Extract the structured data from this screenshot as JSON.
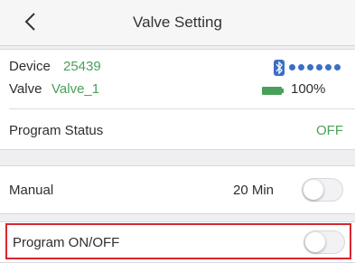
{
  "navbar": {
    "title": "Valve Setting",
    "back_icon": "chevron-left-icon"
  },
  "device": {
    "label": "Device",
    "id": "25439"
  },
  "valve": {
    "label": "Valve",
    "name": "Valve_1"
  },
  "status": {
    "bluetooth_icon": "bluetooth-icon",
    "signal_icon": "signal-dots-icon",
    "battery_icon": "battery-icon",
    "battery": "100%"
  },
  "program_status": {
    "label": "Program Status",
    "value": "OFF"
  },
  "manual": {
    "label": "Manual",
    "duration": "20 Min",
    "toggle_on": false
  },
  "program": {
    "label": "Program ON/OFF",
    "toggle_on": false
  },
  "colors": {
    "accent_green": "#4aa05a",
    "highlight_red": "#d7262e",
    "bluetooth_blue": "#3a6fc4"
  }
}
